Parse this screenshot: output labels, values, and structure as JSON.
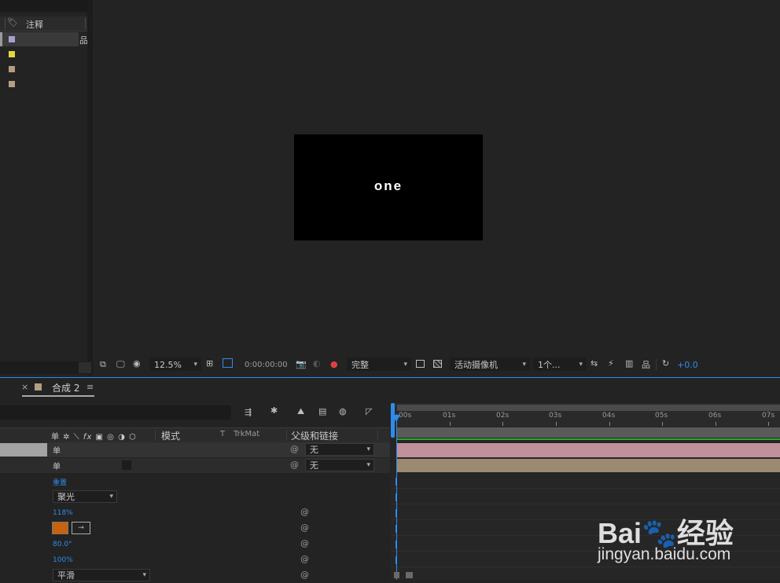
{
  "project_panel": {
    "column_note_label": "注释",
    "rows": [
      {
        "swatch": "#a79fd0"
      },
      {
        "swatch": "#e6d640"
      },
      {
        "swatch": "#b39e7f"
      },
      {
        "swatch": "#b39e7f"
      }
    ]
  },
  "viewer": {
    "comp_text": "one",
    "toolbar": {
      "zoom": "12.5%",
      "timecode": "0:00:00:00",
      "resolution": "完整",
      "camera": "活动摄像机",
      "views": "1个...",
      "exposure": "+0.0"
    }
  },
  "timeline": {
    "tab_close": "×",
    "tab_title": "合成 2",
    "tab_menu": "≡",
    "tab_color": "#b39e7f",
    "columns": {
      "mode": "模式",
      "t": "T",
      "trkmat": "TrkMat",
      "parent": "父级和链接"
    },
    "layers": [
      {
        "parent_value": "无"
      },
      {
        "parent_value": "无"
      }
    ],
    "properties": {
      "reset_label": "重置",
      "light_type": "聚光",
      "intensity": "118%",
      "color_swatch": "#c7630e",
      "cone_angle": "80.0°",
      "cone_feather": "100%",
      "falloff": "平滑"
    },
    "ruler_labels": [
      "00s",
      "01s",
      "02s",
      "03s",
      "04s",
      "05s",
      "06s",
      "07s"
    ]
  },
  "watermark": {
    "logo": "Bai🐾经验",
    "url": "jingyan.baidu.com"
  }
}
